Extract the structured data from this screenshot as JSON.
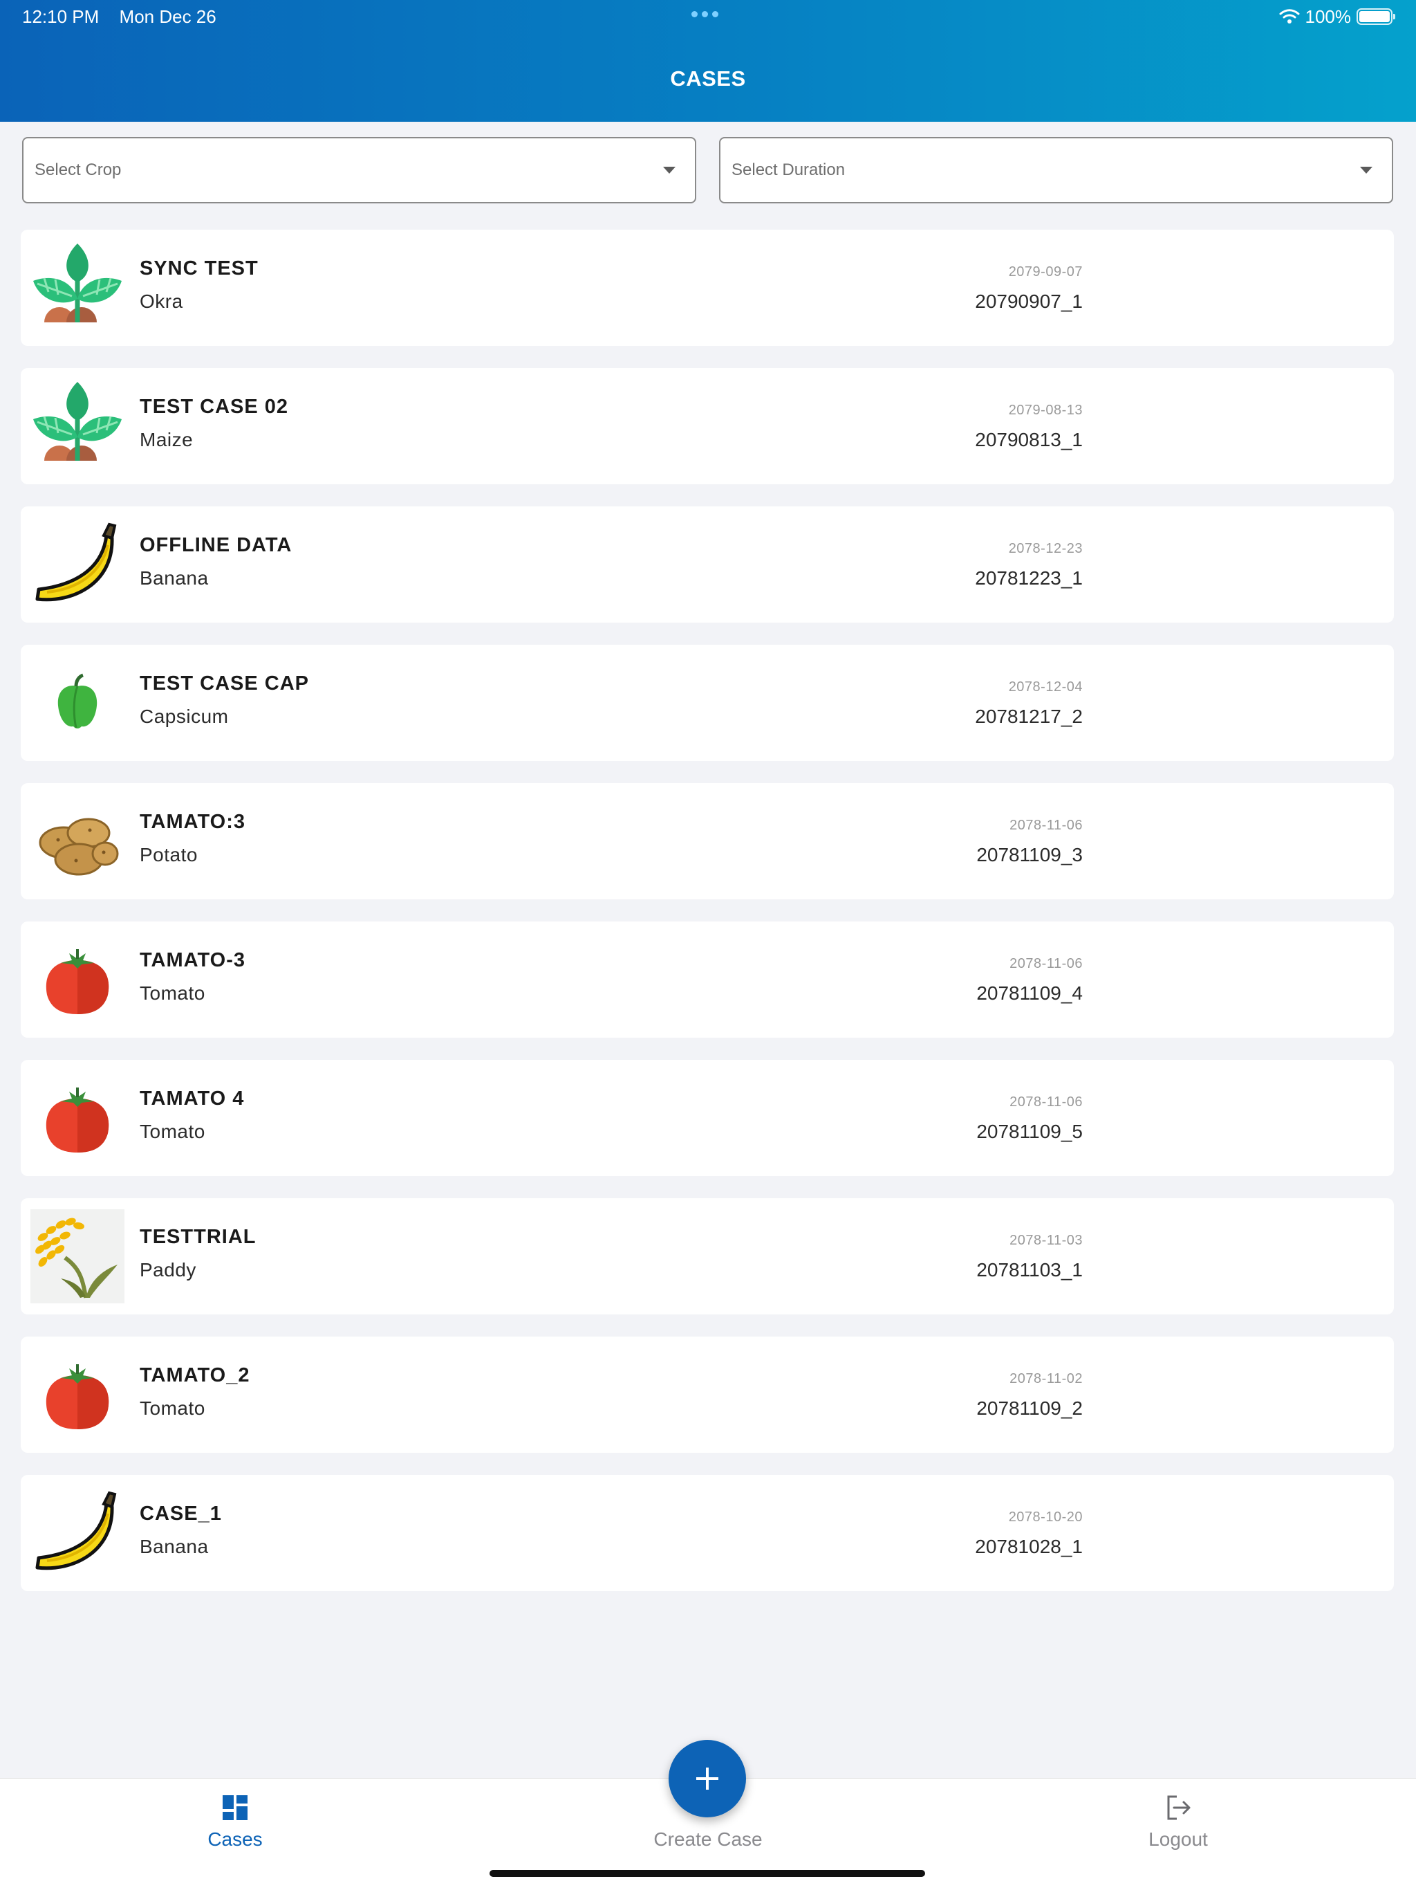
{
  "status_bar": {
    "time": "12:10 PM",
    "date": "Mon Dec 26",
    "battery": "100%"
  },
  "header": {
    "title": "CASES"
  },
  "filters": {
    "crop_placeholder": "Select Crop",
    "duration_placeholder": "Select Duration"
  },
  "cases": [
    {
      "title": "SYNC TEST",
      "crop": "Okra",
      "date": "2079-09-07",
      "id": "20790907_1",
      "icon": "sprout-icon"
    },
    {
      "title": "TEST CASE 02",
      "crop": "Maize",
      "date": "2079-08-13",
      "id": "20790813_1",
      "icon": "sprout-icon"
    },
    {
      "title": "OFFLINE DATA",
      "crop": "Banana",
      "date": "2078-12-23",
      "id": "20781223_1",
      "icon": "banana-icon"
    },
    {
      "title": "TEST CASE CAP",
      "crop": "Capsicum",
      "date": "2078-12-04",
      "id": "20781217_2",
      "icon": "capsicum-icon"
    },
    {
      "title": "TAMATO:3",
      "crop": "Potato",
      "date": "2078-11-06",
      "id": "20781109_3",
      "icon": "potato-icon"
    },
    {
      "title": "TAMATO-3",
      "crop": "Tomato",
      "date": "2078-11-06",
      "id": "20781109_4",
      "icon": "tomato-icon"
    },
    {
      "title": "TAMATO 4",
      "crop": "Tomato",
      "date": "2078-11-06",
      "id": "20781109_5",
      "icon": "tomato-icon"
    },
    {
      "title": "TESTTRIAL",
      "crop": "Paddy",
      "date": "2078-11-03",
      "id": "20781103_1",
      "icon": "paddy-icon"
    },
    {
      "title": "TAMATO_2",
      "crop": "Tomato",
      "date": "2078-11-02",
      "id": "20781109_2",
      "icon": "tomato-icon"
    },
    {
      "title": "CASE_1",
      "crop": "Banana",
      "date": "2078-10-20",
      "id": "20781028_1",
      "icon": "banana-icon"
    }
  ],
  "tabbar": {
    "cases_label": "Cases",
    "create_label": "Create Case",
    "logout_label": "Logout"
  },
  "colors": {
    "header_start": "#0a63b8",
    "header_end": "#05a1cc",
    "active_tab": "#0d63b6",
    "inactive_tab": "#8a8a8e",
    "fab": "#0d63b6"
  }
}
